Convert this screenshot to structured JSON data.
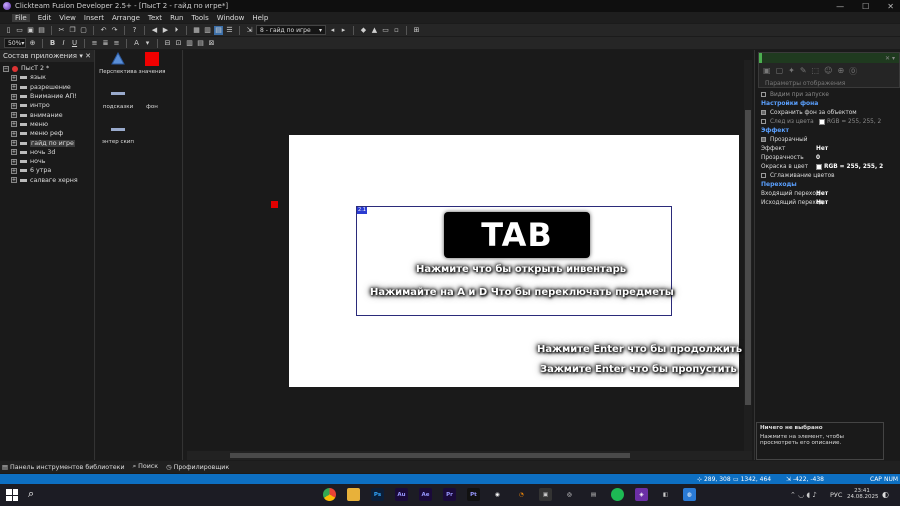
{
  "window": {
    "title": "Clickteam Fusion Developer 2.5+ - [ПысТ 2 - гайд по игре*]",
    "min": "—",
    "max": "☐",
    "close": "✕"
  },
  "menu": [
    "File",
    "Edit",
    "View",
    "Insert",
    "Arrange",
    "Text",
    "Run",
    "Tools",
    "Window",
    "Help"
  ],
  "toolbar": {
    "frame_combo": "8 - гайд по игре",
    "zoom_combo": "50%"
  },
  "workspace": {
    "header": "Состав приложения",
    "root": "ПысТ 2 *",
    "items": [
      "язык",
      "разрешение",
      "Внимание АП!",
      "интро",
      "внимание",
      "меню",
      "меню реф",
      "гайд по игре",
      "ночь 3d",
      "ночь",
      "6 утра",
      "салвагe херня"
    ],
    "selected_index": 7
  },
  "objects": [
    {
      "label": "Перспектива",
      "icon": "perspective-icon"
    },
    {
      "label": "значения",
      "icon": "counter-icon",
      "color": "#ff0000"
    },
    {
      "label": "подсказки",
      "icon": "string-icon"
    },
    {
      "label": "фон",
      "icon": "backdrop-icon"
    },
    {
      "label": "энтер скип",
      "icon": "string-icon"
    }
  ],
  "scene": {
    "group_tag": "2.1",
    "tab_label": "TAB",
    "line1": "Нажмите что бы открыть инвентарь",
    "line2": "Нажимайте на A и D Что бы переключать предметы",
    "line3": "Нажмите Enter что бы продолжить",
    "line4": "Зажмите Enter что бы пропустить"
  },
  "properties": {
    "faded_top": "Параметры отображения",
    "faded_row": "Видим при запуске",
    "cat_background": "Настройки фона",
    "save_bg": "Сохранить фон за объектом",
    "trail": "След из цвета",
    "trail_value": "RGB = 255, 255, 2",
    "cat_effect": "Эффект",
    "transparent": "Прозрачный",
    "effect_k": "Эффект",
    "effect_v": "Нет",
    "opacity_k": "Прозрачность",
    "opacity_v": "0",
    "tint_k": "Окраска в цвет",
    "tint_v": "RGB = 255, 255, 2",
    "smooth": "Сглаживание цветов",
    "cat_transitions": "Переходы",
    "in_k": "Входящий переход",
    "in_v": "Нет",
    "out_k": "Исходящий переход",
    "out_v": "Нет"
  },
  "info": {
    "title": "Ничего не выбрано",
    "text": "Нажмите на элемент, чтобы просмотреть его описание."
  },
  "bottom_tabs": [
    "Панель инструментов библиотеки",
    "Поиск",
    "Профилировщик"
  ],
  "status": {
    "coords": "289, 308",
    "size": "1342, 464",
    "delta": "-422, -438",
    "caps": "CAP",
    "num": "NUM"
  },
  "taskbar": {
    "lang": "РУС",
    "time": "23:41",
    "date": "24.08.2025"
  }
}
